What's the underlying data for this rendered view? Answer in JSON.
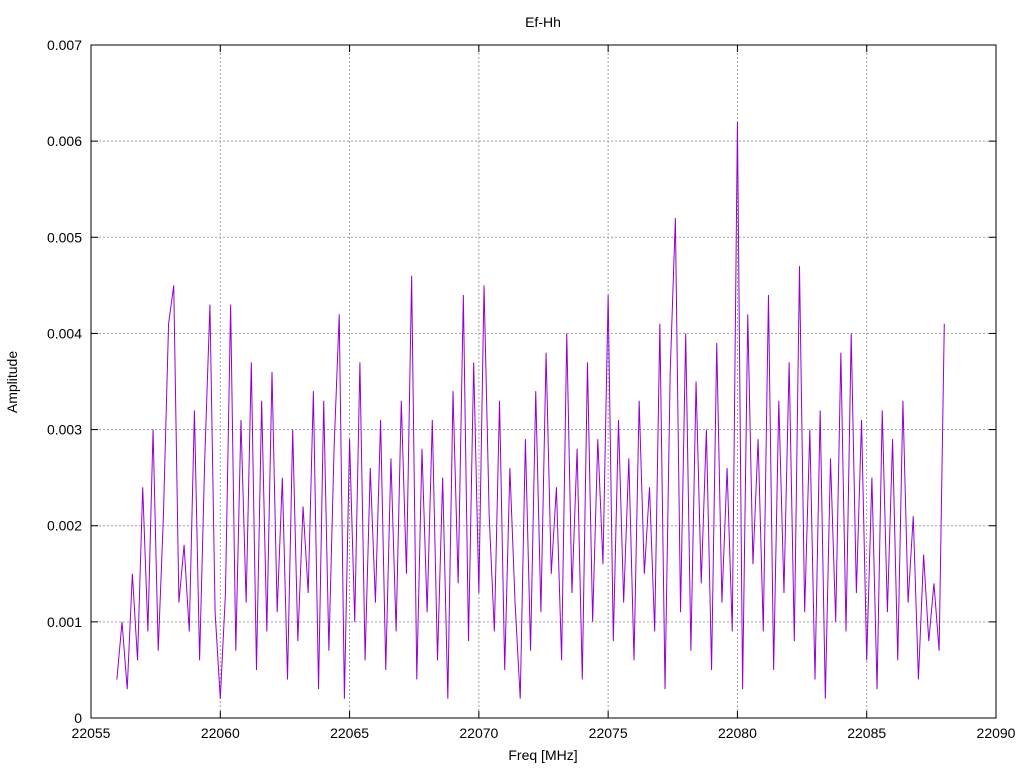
{
  "chart_data": {
    "type": "line",
    "title": "Ef-Hh",
    "xlabel": "Freq [MHz]",
    "ylabel": "Amplitude",
    "xlim": [
      22055,
      22090
    ],
    "ylim": [
      0,
      0.007
    ],
    "xticks": [
      22055,
      22060,
      22065,
      22070,
      22075,
      22080,
      22085,
      22090
    ],
    "xtick_labels": [
      "22055",
      "22060",
      "22065",
      "22070",
      "22075",
      "22080",
      "22085",
      "22090"
    ],
    "yticks": [
      0,
      0.001,
      0.002,
      0.003,
      0.004,
      0.005,
      0.006,
      0.007
    ],
    "ytick_labels": [
      "0",
      "0.001",
      "0.002",
      "0.003",
      "0.004",
      "0.005",
      "0.006",
      "0.007"
    ],
    "grid": true,
    "legend": "none",
    "series": [
      {
        "name": "Ef-Hh",
        "color": "#9400d3",
        "x_start": 22056.0,
        "x_step": 0.2,
        "values": [
          0.0004,
          0.001,
          0.0003,
          0.0015,
          0.0006,
          0.0024,
          0.0009,
          0.003,
          0.0007,
          0.0021,
          0.0041,
          0.0045,
          0.0012,
          0.0018,
          0.0009,
          0.0032,
          0.0006,
          0.0027,
          0.0043,
          0.0011,
          0.0002,
          0.0013,
          0.0043,
          0.0007,
          0.0031,
          0.0012,
          0.0037,
          0.0005,
          0.0033,
          0.0009,
          0.0036,
          0.0011,
          0.0025,
          0.0004,
          0.003,
          0.0008,
          0.0022,
          0.0013,
          0.0034,
          0.0003,
          0.0033,
          0.0007,
          0.0028,
          0.0042,
          0.0002,
          0.0029,
          0.001,
          0.0037,
          0.0006,
          0.0026,
          0.0012,
          0.0031,
          0.0005,
          0.0027,
          0.0009,
          0.0033,
          0.0015,
          0.0046,
          0.0004,
          0.0028,
          0.0011,
          0.0031,
          0.0006,
          0.0025,
          0.0002,
          0.0034,
          0.0014,
          0.0044,
          0.0008,
          0.0037,
          0.0013,
          0.0045,
          0.0021,
          0.0009,
          0.0033,
          0.0005,
          0.0026,
          0.0012,
          0.0002,
          0.0029,
          0.0007,
          0.0034,
          0.0011,
          0.0038,
          0.0015,
          0.0024,
          0.0006,
          0.004,
          0.0013,
          0.0028,
          0.0004,
          0.0037,
          0.001,
          0.0029,
          0.0016,
          0.0044,
          0.0008,
          0.0031,
          0.0012,
          0.0027,
          0.0006,
          0.0033,
          0.0015,
          0.0024,
          0.0009,
          0.0041,
          0.0003,
          0.0036,
          0.0052,
          0.0011,
          0.004,
          0.0007,
          0.0035,
          0.0014,
          0.003,
          0.0005,
          0.0039,
          0.0012,
          0.0026,
          0.0009,
          0.0062,
          0.0003,
          0.0042,
          0.0016,
          0.0029,
          0.0009,
          0.0044,
          0.0005,
          0.0033,
          0.0013,
          0.0037,
          0.0008,
          0.0047,
          0.0011,
          0.003,
          0.0004,
          0.0032,
          0.0002,
          0.0027,
          0.001,
          0.0038,
          0.0009,
          0.004,
          0.0013,
          0.0031,
          0.0006,
          0.0025,
          0.0003,
          0.0032,
          0.0011,
          0.0029,
          0.0006,
          0.0033,
          0.0012,
          0.0021,
          0.0004,
          0.0017,
          0.0008,
          0.0014,
          0.0007,
          0.0041
        ]
      }
    ]
  }
}
